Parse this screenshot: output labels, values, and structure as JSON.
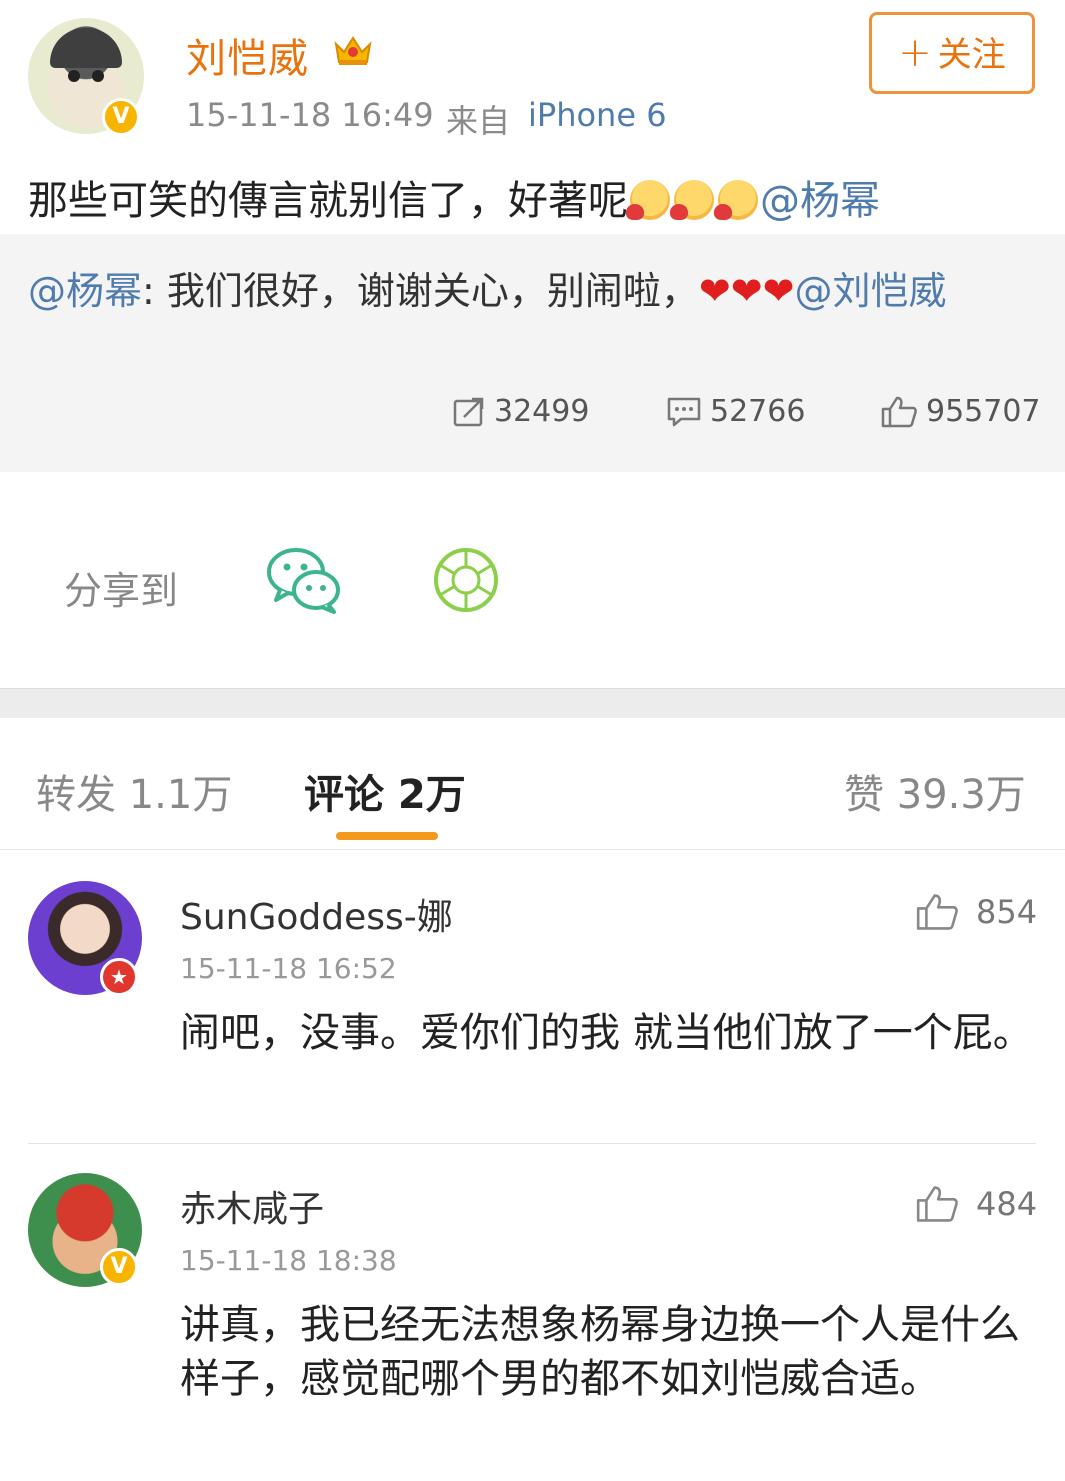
{
  "post": {
    "username": "刘恺威",
    "timestamp": "15-11-18 16:49",
    "source_label": "来自",
    "source_device": "iPhone 6",
    "follow_label": "关注",
    "text": "那些可笑的傳言就别信了，好著呢",
    "mention": "@杨幂"
  },
  "quote": {
    "author_mention": "@杨幂",
    "text": ": 我们很好，谢谢关心，别闹啦，",
    "hearts": "❤❤❤",
    "trailing_mention": "@刘恺威",
    "repost_count": "32499",
    "comment_count": "52766",
    "like_count": "955707"
  },
  "share": {
    "label": "分享到",
    "icons": [
      "wechat-icon",
      "moments-icon"
    ]
  },
  "tabs": {
    "repost": "转发 1.1万",
    "comment": "评论 2万",
    "like": "赞 39.3万"
  },
  "comments": [
    {
      "name": "SunGoddess-娜",
      "time": "15-11-18 16:52",
      "likes": "854",
      "text": "闹吧，没事。爱你们的我 就当他们放了一个屁。"
    },
    {
      "name": "赤木咸子",
      "time": "15-11-18 18:38",
      "likes": "484",
      "text": "讲真，我已经无法想象杨幂身边换一个人是什么样子，感觉配哪个男的都不如刘恺威合适。"
    }
  ],
  "colors": {
    "accent_orange": "#e8730c",
    "link_blue": "#4f7cad",
    "tab_indicator": "#f39a1c",
    "verified_yellow": "#f7b500"
  }
}
